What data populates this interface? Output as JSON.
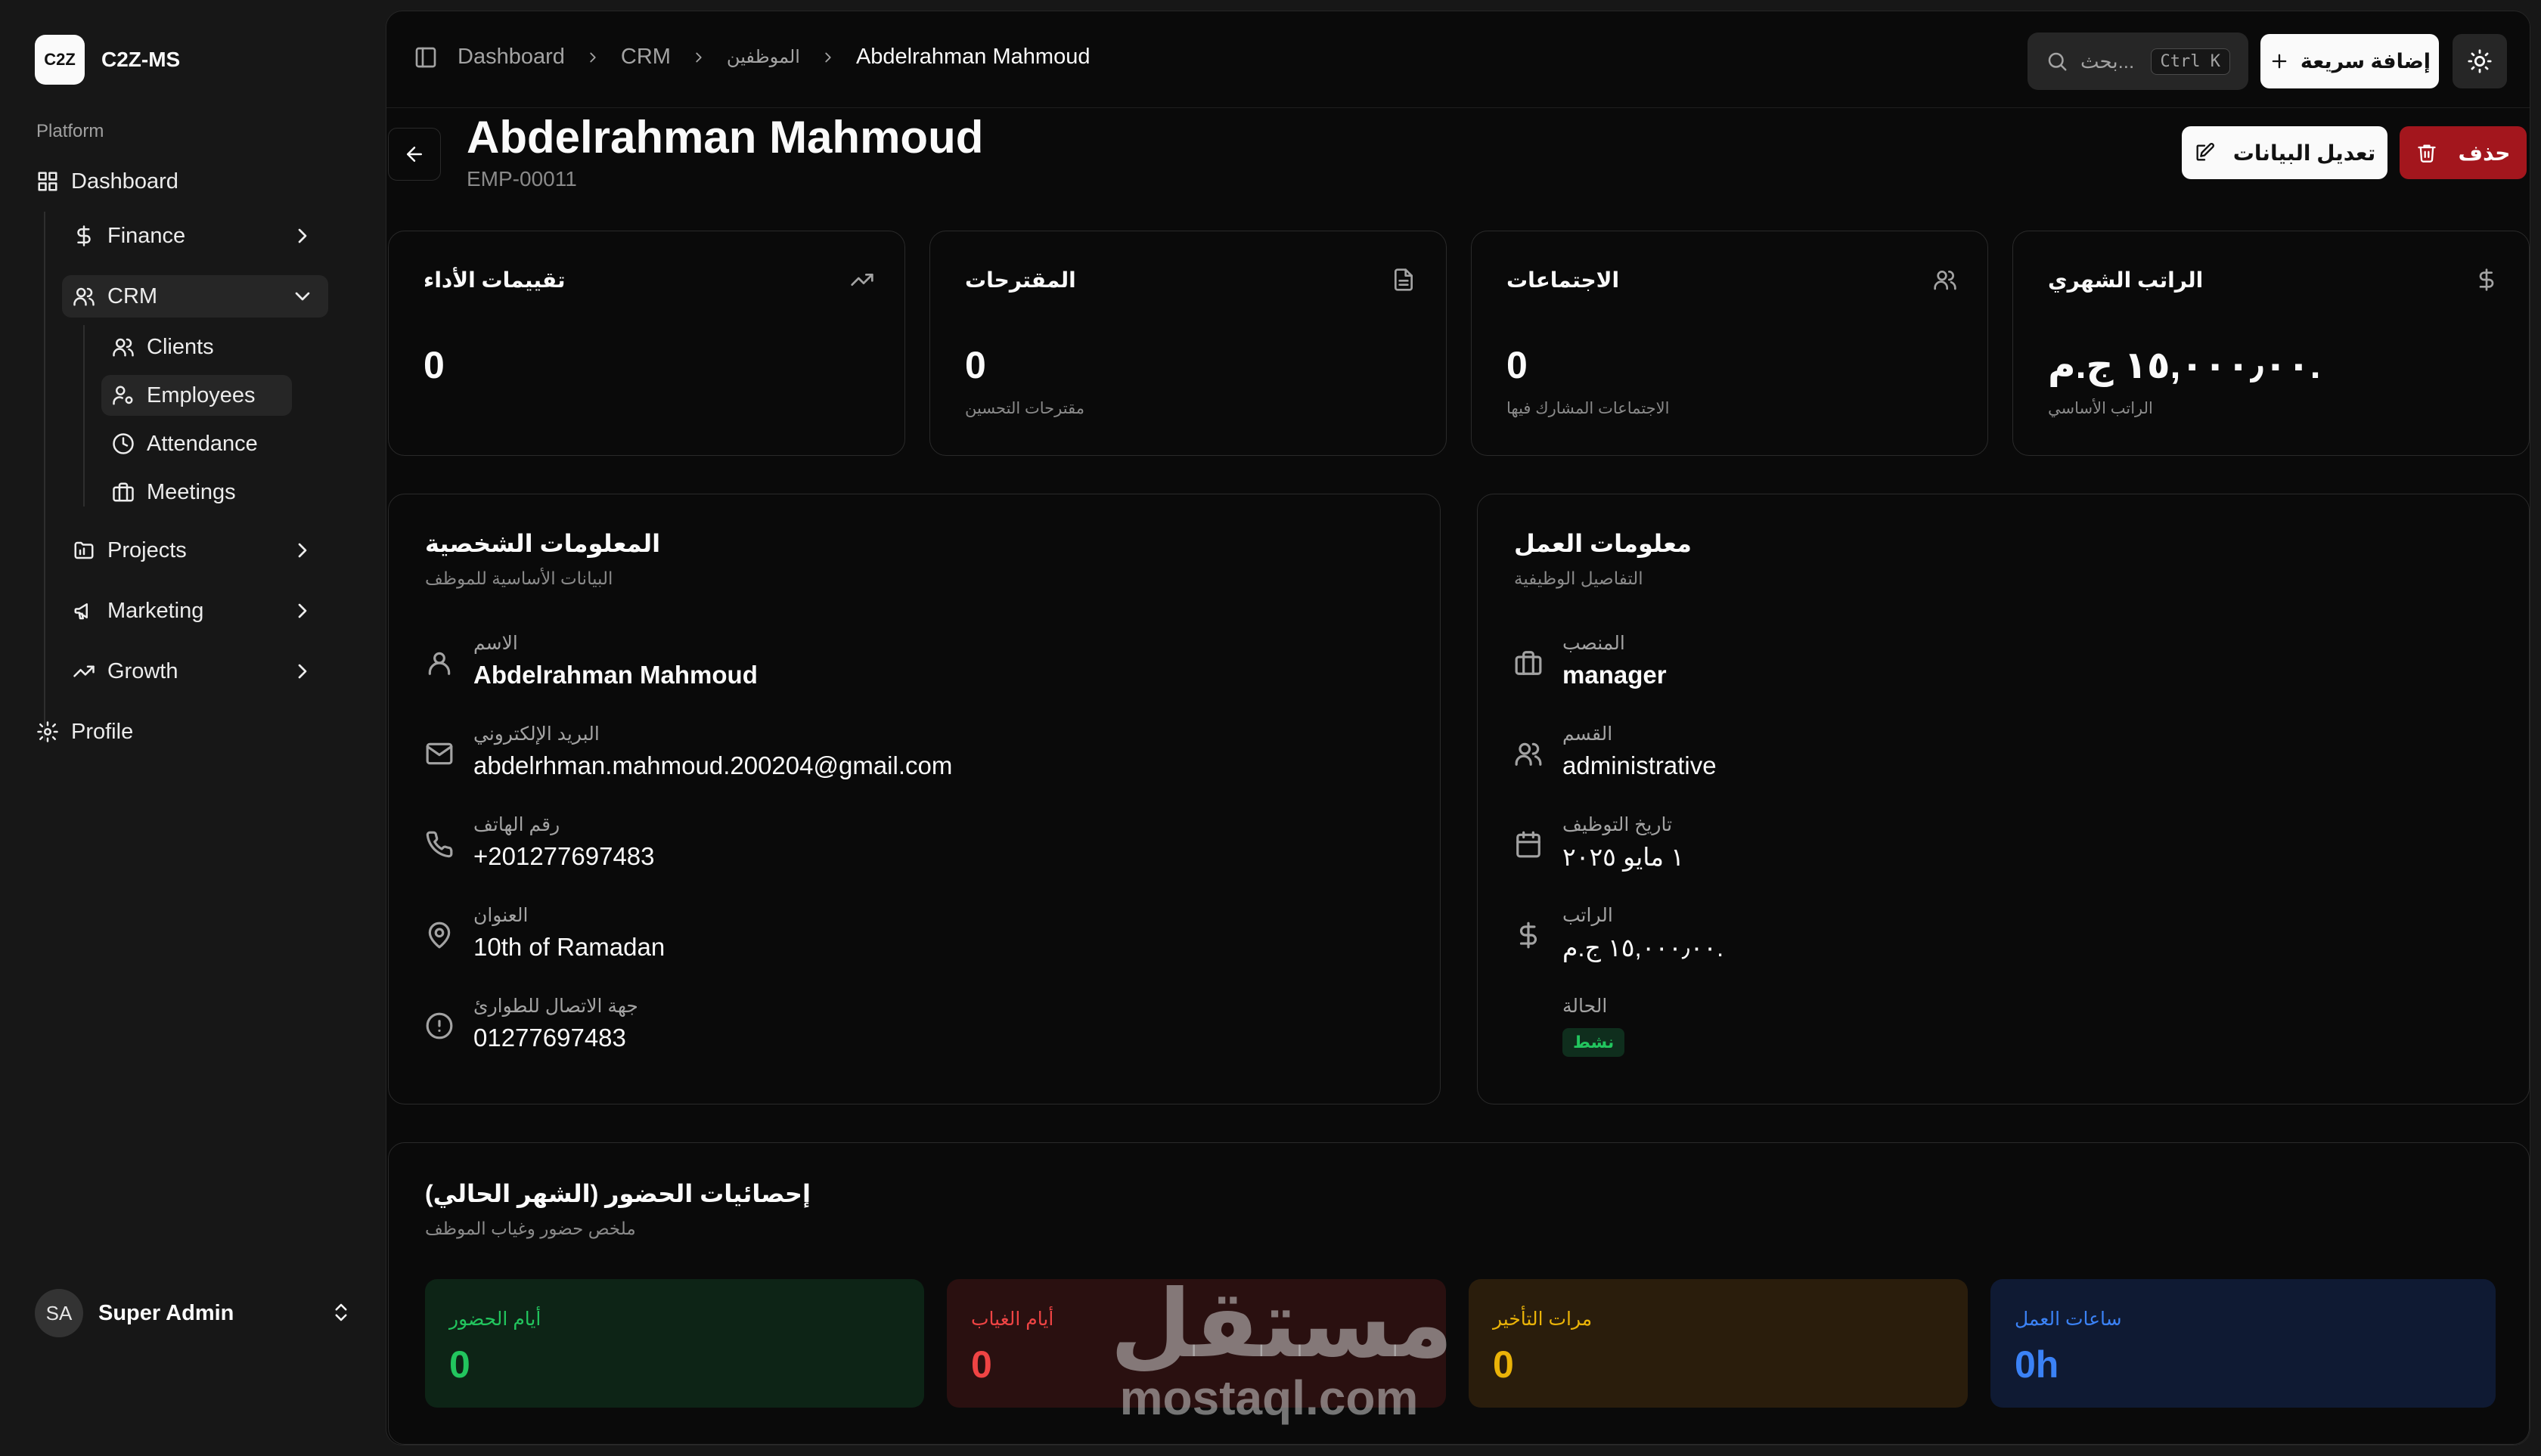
{
  "brand": {
    "logo": "C2Z",
    "name": "C2Z-MS"
  },
  "sidebar": {
    "group_label": "Platform",
    "items": [
      {
        "label": "Dashboard",
        "icon": "grid-icon"
      },
      {
        "label": "Finance",
        "icon": "dollar-icon"
      },
      {
        "label": "CRM",
        "icon": "users-icon"
      },
      {
        "label": "Clients",
        "icon": "users-icon"
      },
      {
        "label": "Employees",
        "icon": "user-cog-icon"
      },
      {
        "label": "Attendance",
        "icon": "clock-icon"
      },
      {
        "label": "Meetings",
        "icon": "briefcase-icon"
      },
      {
        "label": "Projects",
        "icon": "folder-icon"
      },
      {
        "label": "Marketing",
        "icon": "megaphone-icon"
      },
      {
        "label": "Growth",
        "icon": "trending-up-icon"
      },
      {
        "label": "Profile",
        "icon": "gear-icon"
      }
    ],
    "user": {
      "initials": "SA",
      "name": "Super Admin"
    }
  },
  "header": {
    "breadcrumbs": [
      "Dashboard",
      "CRM",
      "الموظفين",
      "Abdelrahman Mahmoud"
    ],
    "search_placeholder": "بحث...",
    "search_shortcut": "Ctrl K",
    "quick_add_label": "إضافة سريعة"
  },
  "page": {
    "title": "Abdelrahman Mahmoud",
    "employee_id": "EMP-00011",
    "edit_label": "تعديل البيانات",
    "delete_label": "حذف"
  },
  "stats": [
    {
      "title": "تقييمات الأداء",
      "value": "0",
      "sub": "",
      "icon": "trending-up-icon"
    },
    {
      "title": "المقترحات",
      "value": "0",
      "sub": "مقترحات التحسين",
      "icon": "file-icon"
    },
    {
      "title": "الاجتماعات",
      "value": "0",
      "sub": "الاجتماعات المشارك فيها",
      "icon": "users-icon"
    },
    {
      "title": "الراتب الشهري",
      "value": "١٥,٠٠٠٫٠٠ ج.م.",
      "sub": "الراتب الأساسي",
      "icon": "dollar-icon"
    }
  ],
  "personal": {
    "title": "المعلومات الشخصية",
    "subtitle": "البيانات الأساسية للموظف",
    "rows": [
      {
        "label": "الاسم",
        "value": "Abdelrahman Mahmoud",
        "icon": "user-icon"
      },
      {
        "label": "البريد الإلكتروني",
        "value": "abdelrhman.mahmoud.200204@gmail.com",
        "icon": "mail-icon"
      },
      {
        "label": "رقم الهاتف",
        "value": "+201277697483",
        "icon": "phone-icon"
      },
      {
        "label": "العنوان",
        "value": "10th of Ramadan",
        "icon": "map-pin-icon"
      },
      {
        "label": "جهة الاتصال للطوارئ",
        "value": "01277697483",
        "icon": "alert-circle-icon"
      }
    ]
  },
  "work": {
    "title": "معلومات العمل",
    "subtitle": "التفاصيل الوظيفية",
    "rows": [
      {
        "label": "المنصب",
        "value": "manager",
        "icon": "briefcase-icon"
      },
      {
        "label": "القسم",
        "value": "administrative",
        "icon": "users-icon"
      },
      {
        "label": "تاريخ التوظيف",
        "value": "١ مايو ٢٠٢٥",
        "icon": "calendar-icon"
      },
      {
        "label": "الراتب",
        "value": "١٥,٠٠٠٫٠٠ ج.م.",
        "icon": "dollar-icon"
      },
      {
        "label": "الحالة",
        "value": "نشط",
        "icon": ""
      }
    ]
  },
  "attendance": {
    "title": "إحصائيات الحضور (الشهر الحالي)",
    "subtitle": "ملخص حضور وغياب الموظف",
    "boxes": [
      {
        "label": "أيام الحضور",
        "value": "0",
        "color": "#22c55e",
        "bg": "#0d2416"
      },
      {
        "label": "أيام الغياب",
        "value": "0",
        "color": "#ef4444",
        "bg": "#2a1010"
      },
      {
        "label": "مرات التأخير",
        "value": "0",
        "color": "#eab308",
        "bg": "#2a1d0c"
      },
      {
        "label": "ساعات العمل",
        "value": "0h",
        "color": "#3b82f6",
        "bg": "#0f1a33"
      }
    ]
  },
  "watermark": {
    "arabic": "مستقل",
    "latin": "mostaql.com"
  }
}
